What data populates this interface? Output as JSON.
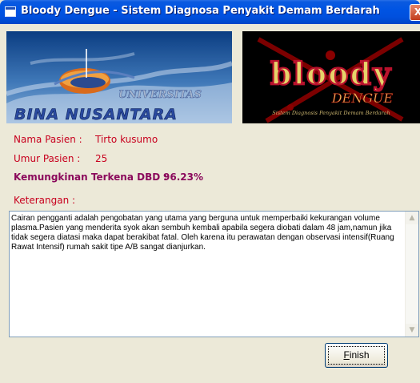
{
  "window": {
    "title": "Bloody Dengue - Sistem Diagnosa Penyakit Demam Berdarah",
    "close_label": "X"
  },
  "banner": {
    "left_logo_text_1": "UNIVERSITAS",
    "left_logo_text_2": "BINA NUSANTARA",
    "right_logo_text_1": "bloody",
    "right_logo_text_2": "DENGUE",
    "right_logo_tagline": "Sistem Diagnosis Penyakit Demam Berdarah"
  },
  "patient": {
    "name_label": "Nama Pasien :",
    "name_value": "Tirto kusumo",
    "age_label": "Umur Pasien :",
    "age_value": "25"
  },
  "result": {
    "label": "Kemungkinan Terkena DBD :",
    "value": "96.23%"
  },
  "notes": {
    "label": "Keterangan :",
    "text": "Cairan pengganti adalah pengobatan yang utama yang berguna untuk memperbaiki kekurangan volume plasma.Pasien yang menderita syok akan sembuh kembali apabila segera diobati dalam 48 jam,namun jika tidak segera diatasi maka dapat berakibat fatal. Oleh karena itu perawatan dengan observasi intensif(Ruang Rawat Intensif) rumah sakit tipe A/B sangat dianjurkan."
  },
  "buttons": {
    "finish_first": "F",
    "finish_rest": "inish"
  },
  "colors": {
    "label_red": "#c8001e",
    "result_purple": "#8b0a5c",
    "titlebar_blue": "#0054e3"
  }
}
